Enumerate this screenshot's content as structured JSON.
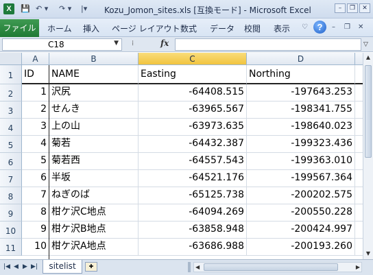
{
  "window": {
    "title": "Kozu_Jomon_sites.xls  [互換モード] - Microsoft Excel",
    "app_icon": "X",
    "undo_icon": "undo-icon",
    "redo_icon": "redo-icon",
    "minimize": "–",
    "restore": "❐",
    "close": "✕"
  },
  "ribbon": {
    "file_tab": "ファイル",
    "tabs": [
      "ホーム",
      "挿入",
      "ページ レイアウト",
      "数式",
      "データ",
      "校閲",
      "表示"
    ],
    "help": "?"
  },
  "formula_bar": {
    "name_box": "C18",
    "fx_label": "fx",
    "value": ""
  },
  "grid": {
    "columns": [
      "A",
      "B",
      "C",
      "D"
    ],
    "selected_column": "C",
    "row_numbers": [
      "1",
      "2",
      "3",
      "4",
      "5",
      "6",
      "7",
      "8",
      "9",
      "10",
      "11"
    ],
    "header": [
      "ID",
      "NAME",
      "Easting",
      "Northing"
    ],
    "rows": [
      [
        "1",
        "沢尻",
        "-64408.515",
        "-197643.253"
      ],
      [
        "2",
        "せんき",
        "-63965.567",
        "-198341.755"
      ],
      [
        "3",
        "上の山",
        "-63973.635",
        "-198640.023"
      ],
      [
        "4",
        "菊若",
        "-64432.387",
        "-199323.436"
      ],
      [
        "5",
        "菊若西",
        "-64557.543",
        "-199363.010"
      ],
      [
        "6",
        "半坂",
        "-64521.176",
        "-199567.364"
      ],
      [
        "7",
        "ねぎのば",
        "-65125.738",
        "-200202.575"
      ],
      [
        "8",
        "柑ケ沢C地点",
        "-64094.269",
        "-200550.228"
      ],
      [
        "9",
        "柑ケ沢B地点",
        "-63858.948",
        "-200424.997"
      ],
      [
        "10",
        "柑ケ沢A地点",
        "-63686.988",
        "-200193.260"
      ]
    ]
  },
  "sheets": {
    "active": "sitelist"
  }
}
